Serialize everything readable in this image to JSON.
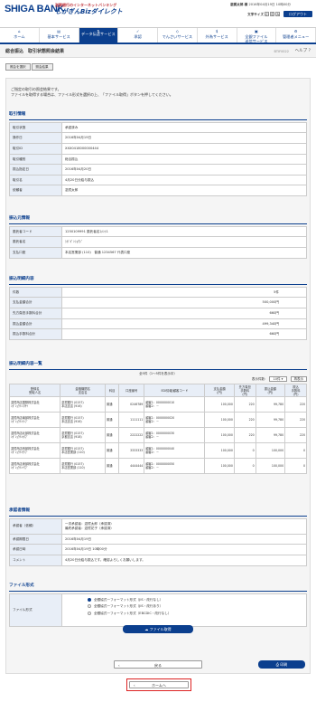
{
  "header": {
    "logo": "SHIGA BANK",
    "brand_line1": "滋賀銀行のインターネットバンキング",
    "brand_line2": "しがぎんBizダイレクト",
    "user": "滋賀太郎 様",
    "timestamp": "2016年04月19日 10時00分",
    "font_size_label": "文字サイズ",
    "font_sizes": [
      "小",
      "中",
      "大"
    ],
    "logout": "ログアウト"
  },
  "nav": {
    "items": [
      "ホーム",
      "基本サービス",
      "データ伝送サービス",
      "承認",
      "でんさいサービス",
      "外為サービス",
      "全銀ファイル\n送信サービス",
      "管理者メニュー"
    ]
  },
  "page": {
    "title": "総合振込　取引状態照会結果",
    "code": "BTIF0022",
    "help": "ヘルプ"
  },
  "breadcrumb": [
    "照会を選択",
    "照会結果"
  ],
  "intro": [
    "ご指定の取引の照会結果です。",
    "ファイルを取得する場合は、ファイル形式を選択の上、「ファイル取得」ボタンを押してください。"
  ],
  "torihiki": {
    "heading": "取引情報",
    "rows": [
      {
        "k": "取引状態",
        "v": "承認済み"
      },
      {
        "k": "操作日",
        "v": "2016年04月19日"
      },
      {
        "k": "取引ID",
        "v": "XXX0418000000444"
      },
      {
        "k": "取引種別",
        "v": "総合振込"
      },
      {
        "k": "振込指定日",
        "v": "2016年04月20日"
      },
      {
        "k": "取引名",
        "v": "4月20日分給与振込"
      },
      {
        "k": "依頼者",
        "v": "滋賀太郎"
      }
    ]
  },
  "moto": {
    "heading": "振込元情報",
    "rows": [
      {
        "k": "委託者コード",
        "v": "1250109991 委託者名ｺﾒﾝﾄ1"
      },
      {
        "k": "委託者名",
        "v": "ｼｶﾞｷﾞﾝｼｮｳｼﾞ"
      },
      {
        "k": "支払口座",
        "v": "本店営業部 (110)　普通 1234567 代表口座"
      }
    ]
  },
  "meisai": {
    "heading": "振込明細内容",
    "rows": [
      {
        "k": "件数",
        "v": "5件"
      },
      {
        "k": "支払金額合計",
        "v": "500,000円"
      },
      {
        "k": "先方負担手数料合計",
        "v": "660円"
      },
      {
        "k": "振込金額合計",
        "v": "499,340円"
      },
      {
        "k": "振込手数料合計",
        "v": "660円"
      }
    ]
  },
  "ichiran": {
    "heading": "振込明細内容一覧",
    "count": "全5件（1～5件を表示中）",
    "per_page_label": "表示件数：",
    "per_page": "10件",
    "redisplay": "再表示",
    "headers": [
      "登録名\n受取人名",
      "金融機関名\n支店名",
      "科目",
      "口座番号",
      "EDI情報/顧客コード",
      "支払金額\n(円)",
      "先方負担\n手数料\n(円)",
      "振込金額\n(円)",
      "振込\n手数料\n(円)"
    ],
    "rows": [
      {
        "name": "滋賀商店国際株式会社\nｼｶﾞｼｮｳﾃﾝｺｸｻｲ",
        "bank": "滋賀銀行 (0157)\n本店支店 (916)",
        "kamoku": "普通",
        "acct": "0246789",
        "edi": "顧客1：0000000010\n顧客2：－",
        "pay": "100,000",
        "fee": "220",
        "amt": "99,780",
        "tfee": "220"
      },
      {
        "name": "滋賀商店南部株式会社\nｼｶﾞｼｮｳﾃﾝﾅﾝﾌﾞ",
        "bank": "滋賀銀行 (0157)\n本店支店 (916)",
        "kamoku": "普通",
        "acct": "1111111",
        "edi": "顧客1：0000000020\n顧客2：－",
        "pay": "100,000",
        "fee": "220",
        "amt": "99,780",
        "tfee": "220"
      },
      {
        "name": "滋賀商店北部株式会社\nｼｶﾞｼｮｳﾃﾝﾎｸﾌﾞ",
        "bank": "滋賀銀行 (0157)\n京都支店 (918)",
        "kamoku": "普通",
        "acct": "2222222",
        "edi": "顧客1：0000000030\n顧客2：－",
        "pay": "100,000",
        "fee": "220",
        "amt": "99,780",
        "tfee": "220"
      },
      {
        "name": "滋賀商店西部株式会社\nｼｶﾞｼｮｳﾃﾝｾｲﾌﾞ",
        "bank": "滋賀銀行 (0157)\n本店営業部 (110)",
        "kamoku": "普通",
        "acct": "3333333",
        "edi": "顧客1：0000000040\n顧客2：－",
        "pay": "100,000",
        "fee": "0",
        "amt": "100,000",
        "tfee": "0"
      },
      {
        "name": "滋賀商店東部株式会社\nｼｶﾞｼｮｳﾃﾝﾄｳﾌﾞ",
        "bank": "滋賀銀行 (0157)\n本店営業部 (110)",
        "kamoku": "普通",
        "acct": "4444444",
        "edi": "顧客1：0000000050\n顧客2：－",
        "pay": "100,000",
        "fee": "0",
        "amt": "100,000",
        "tfee": "0"
      }
    ]
  },
  "shonin": {
    "heading": "承認者情報",
    "rows": [
      {
        "k": "承認者（依頼）",
        "v": "一次承認者：滋賀太郎（承認済）\n最終承認者：滋賀花子（承認済）"
      },
      {
        "k": "承認期限日",
        "v": "2016年04月19日"
      },
      {
        "k": "承認日時",
        "v": "2016年04月19日 10時00分"
      },
      {
        "k": "コメント",
        "v": "4月20日分給与振込です。確認よろしくお願いします。"
      }
    ]
  },
  "file": {
    "heading": "ファイル形式",
    "label": "ファイル形式",
    "options": [
      "全銀協式一フォーマット形式（JIS・改行なし）",
      "全銀協式一フォーマット形式（JIS・改行あり）",
      "全銀協式一フォーマット形式（EBCDIC・改行なし）"
    ],
    "selected": 0,
    "get_button": "ファイル取得"
  },
  "buttons": {
    "back": "戻る",
    "print": "印刷",
    "home": "ホームへ"
  }
}
